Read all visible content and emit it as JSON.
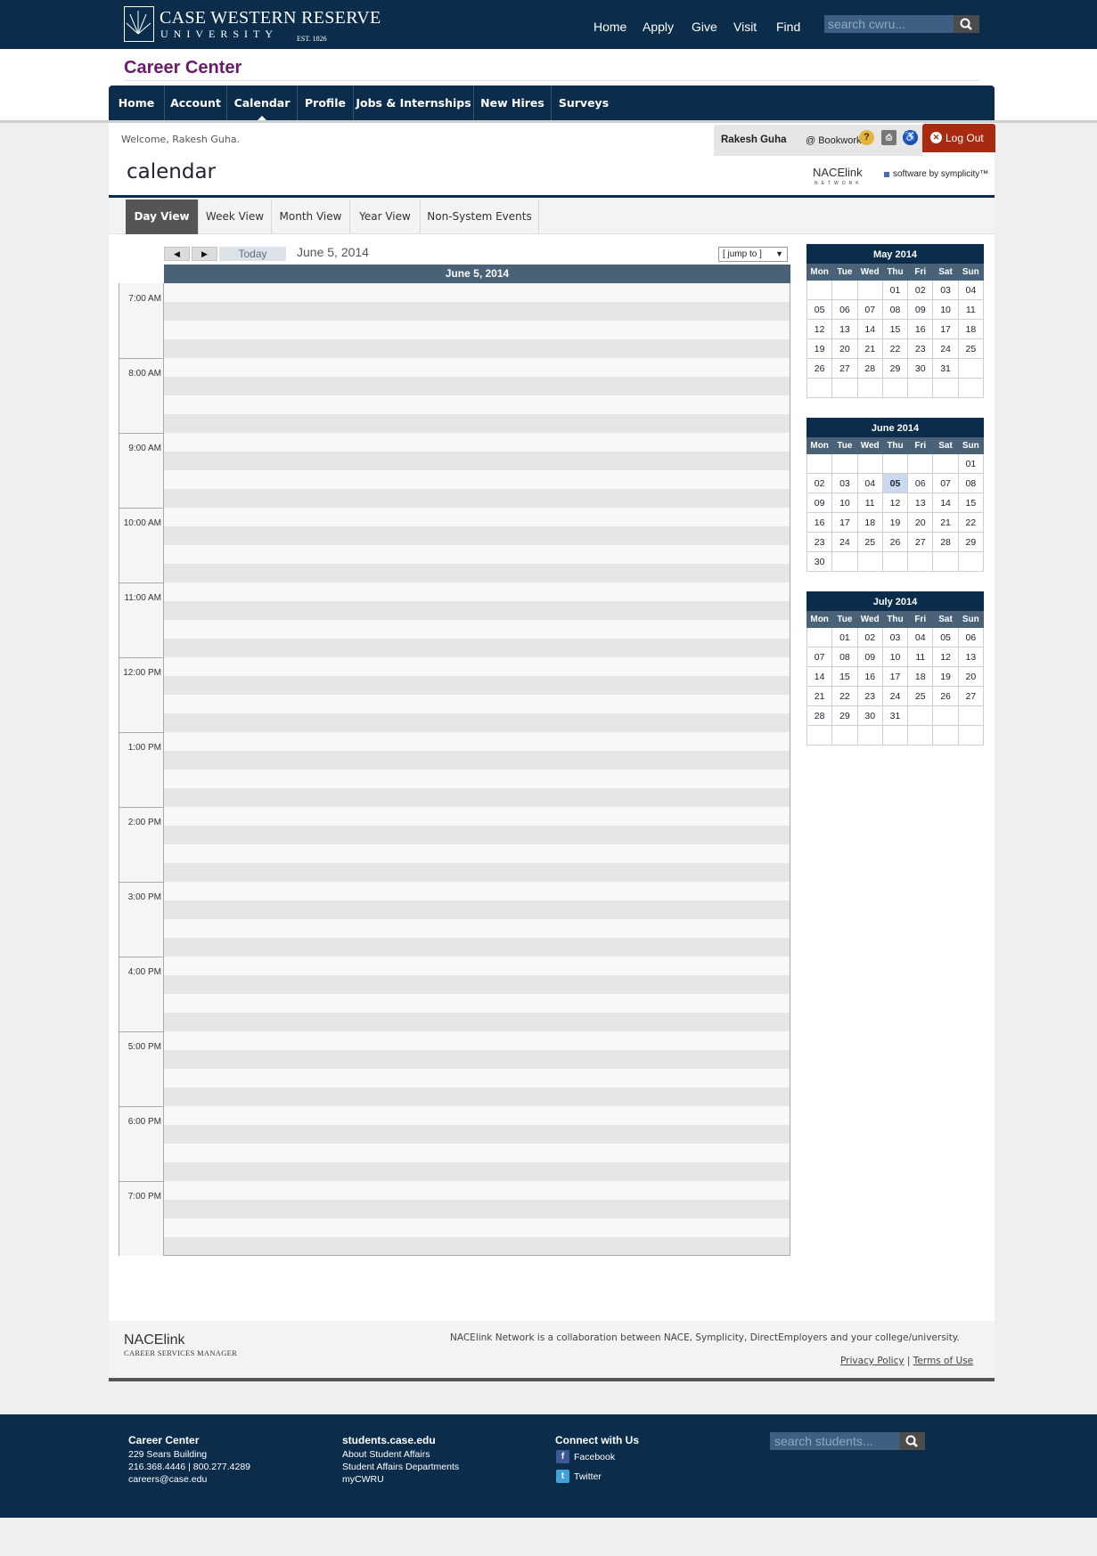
{
  "site": {
    "logo_name": "CASE WESTERN RESERVE",
    "logo_univ": "UNIVERSITY",
    "logo_est": "EST. 1826",
    "nav": [
      "Home",
      "Apply",
      "Give",
      "Visit",
      "Find"
    ],
    "search_placeholder": "search cwru..."
  },
  "header": {
    "title": "Career Center"
  },
  "mainnav": [
    "Home",
    "Account",
    "Calendar",
    "Profile",
    "Jobs & Internships",
    "New Hires",
    "Surveys"
  ],
  "mainnav_active": "Calendar",
  "user": {
    "welcome": "Welcome, Rakesh Guha.",
    "name": "Rakesh Guha",
    "org": "@ Bookwork",
    "logout": "Log Out"
  },
  "page": {
    "title": "calendar",
    "nace": "NACElink",
    "nace_network": "NETWORK",
    "symplicity": "software by symplicity™"
  },
  "tabs": [
    "Day View",
    "Week View",
    "Month View",
    "Year View",
    "Non-System Events"
  ],
  "tab_active": "Day View",
  "day": {
    "today_label": "Today",
    "current_date": "June 5, 2014",
    "jump_label": "[ jump to ]",
    "header": "June 5, 2014",
    "hours": [
      "7:00 AM",
      "8:00 AM",
      "9:00 AM",
      "10:00 AM",
      "11:00 AM",
      "12:00 PM",
      "1:00 PM",
      "2:00 PM",
      "3:00 PM",
      "4:00 PM",
      "5:00 PM",
      "6:00 PM",
      "7:00 PM"
    ]
  },
  "mini_calendars": [
    {
      "title": "May 2014",
      "weekdays": [
        "Mon",
        "Tue",
        "Wed",
        "Thu",
        "Fri",
        "Sat",
        "Sun"
      ],
      "weeks": [
        [
          "",
          "",
          "",
          "01",
          "02",
          "03",
          "04"
        ],
        [
          "05",
          "06",
          "07",
          "08",
          "09",
          "10",
          "11"
        ],
        [
          "12",
          "13",
          "14",
          "15",
          "16",
          "17",
          "18"
        ],
        [
          "19",
          "20",
          "21",
          "22",
          "23",
          "24",
          "25"
        ],
        [
          "26",
          "27",
          "28",
          "29",
          "30",
          "31",
          ""
        ],
        [
          "",
          "",
          "",
          "",
          "",
          "",
          ""
        ]
      ]
    },
    {
      "title": "June 2014",
      "weekdays": [
        "Mon",
        "Tue",
        "Wed",
        "Thu",
        "Fri",
        "Sat",
        "Sun"
      ],
      "selected": "05",
      "weeks": [
        [
          "",
          "",
          "",
          "",
          "",
          "",
          "01"
        ],
        [
          "02",
          "03",
          "04",
          "05",
          "06",
          "07",
          "08"
        ],
        [
          "09",
          "10",
          "11",
          "12",
          "13",
          "14",
          "15"
        ],
        [
          "16",
          "17",
          "18",
          "19",
          "20",
          "21",
          "22"
        ],
        [
          "23",
          "24",
          "25",
          "26",
          "27",
          "28",
          "29"
        ],
        [
          "30",
          "",
          "",
          "",
          "",
          "",
          ""
        ]
      ]
    },
    {
      "title": "July 2014",
      "weekdays": [
        "Mon",
        "Tue",
        "Wed",
        "Thu",
        "Fri",
        "Sat",
        "Sun"
      ],
      "weeks": [
        [
          "",
          "01",
          "02",
          "03",
          "04",
          "05",
          "06"
        ],
        [
          "07",
          "08",
          "09",
          "10",
          "11",
          "12",
          "13"
        ],
        [
          "14",
          "15",
          "16",
          "17",
          "18",
          "19",
          "20"
        ],
        [
          "21",
          "22",
          "23",
          "24",
          "25",
          "26",
          "27"
        ],
        [
          "28",
          "29",
          "30",
          "31",
          "",
          "",
          ""
        ],
        [
          "",
          "",
          "",
          "",
          "",
          "",
          ""
        ]
      ]
    }
  ],
  "page_footer": {
    "logo": "NACElink",
    "sub": "CAREER SERVICES MANAGER",
    "text": "NACElink Network is a collaboration between NACE, Symplicity, DirectEmployers and your college/university.",
    "privacy": "Privacy Policy",
    "separator": "|",
    "terms": "Terms of Use"
  },
  "site_footer": {
    "col1": {
      "title": "Career Center",
      "lines": [
        "229 Sears Building",
        "216.368.4446 | 800.277.4289",
        "careers@case.edu"
      ]
    },
    "col2": {
      "title": "students.case.edu",
      "lines": [
        "About Student Affairs",
        "Student Affairs Departments",
        "myCWRU"
      ]
    },
    "col3": {
      "title": "Connect with Us",
      "facebook": "Facebook",
      "twitter": "Twitter"
    },
    "search_placeholder": "search students..."
  },
  "colors": {
    "navy": "#0b2c4a",
    "slate": "#4a6278",
    "purple": "#6b1a6b",
    "logout_red": "#a82a10"
  }
}
